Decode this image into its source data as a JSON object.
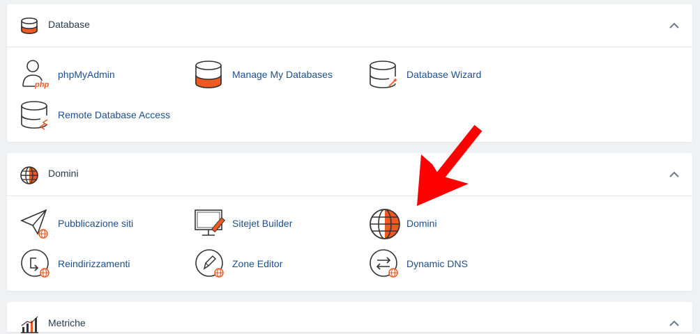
{
  "colors": {
    "accent_orange": "#f05a22",
    "link_blue": "#1e4f8a",
    "icon_dark": "#333333",
    "annotation_red": "#ff0000"
  },
  "database": {
    "title": "Database",
    "icon": "database-icon",
    "items": [
      {
        "label": "phpMyAdmin",
        "icon": "phpmyadmin-icon"
      },
      {
        "label": "Manage My Databases",
        "icon": "manage-databases-icon"
      },
      {
        "label": "Database Wizard",
        "icon": "database-wizard-icon"
      },
      {
        "label": "Remote Database Access",
        "icon": "remote-database-icon"
      }
    ]
  },
  "domini": {
    "title": "Domini",
    "icon": "globe-icon",
    "items": [
      {
        "label": "Pubblicazione siti",
        "icon": "site-publisher-icon"
      },
      {
        "label": "Sitejet Builder",
        "icon": "sitejet-builder-icon"
      },
      {
        "label": "Domini",
        "icon": "domains-globe-icon"
      },
      {
        "label": "Reindirizzamenti",
        "icon": "redirects-icon"
      },
      {
        "label": "Zone Editor",
        "icon": "zone-editor-icon"
      },
      {
        "label": "Dynamic DNS",
        "icon": "dynamic-dns-icon"
      }
    ]
  },
  "metriche": {
    "title": "Metriche",
    "icon": "bar-chart-icon"
  }
}
